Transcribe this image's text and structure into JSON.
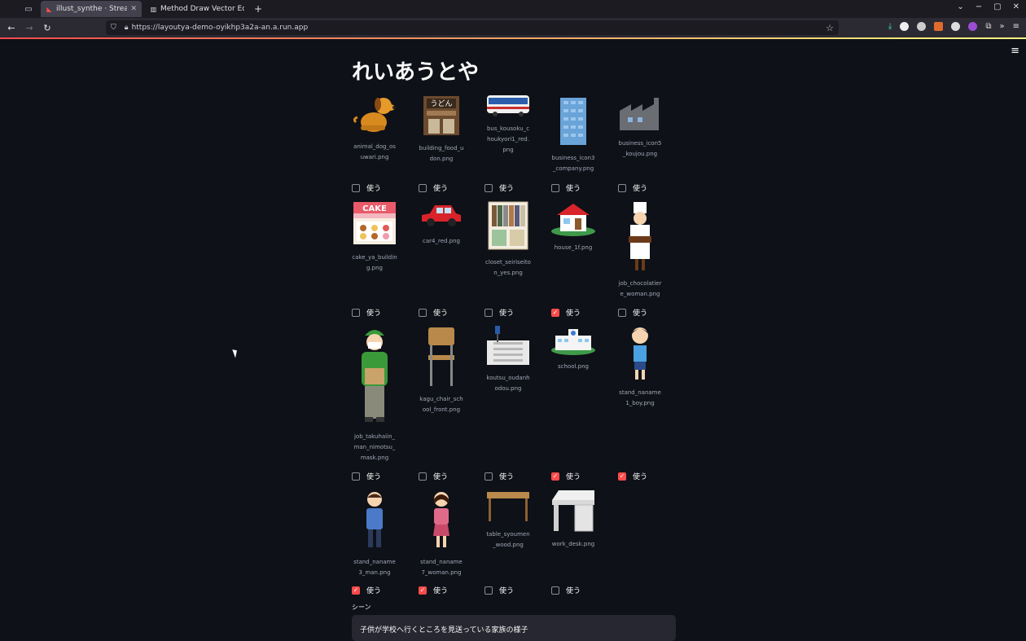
{
  "browser": {
    "tabs": [
      {
        "title": "illust_synthe · Streamlit",
        "active": true
      },
      {
        "title": "Method Draw Vector Edit",
        "active": false
      }
    ],
    "url": "https://layoutya-demo-oyikhp3a2a-an.a.run.app"
  },
  "app": {
    "title": "れいあうとや",
    "use_label": "使う",
    "scene_label": "シーン",
    "scene_value": "子供が学校へ行くところを見送っている家族の様子",
    "accent_color": "#ff4b4b"
  },
  "items": [
    {
      "file": "animal_dog_osuwari.png",
      "checked": false,
      "icon": "dog-illustration"
    },
    {
      "file": "building_food_udon.png",
      "checked": false,
      "icon": "udon-shop-illustration"
    },
    {
      "file": "bus_kousoku_choukyori1_red.png",
      "checked": false,
      "icon": "bus-illustration"
    },
    {
      "file": "business_icon3_company.png",
      "checked": false,
      "icon": "office-building-icon"
    },
    {
      "file": "business_icon5_koujou.png",
      "checked": false,
      "icon": "factory-icon"
    },
    {
      "file": "cake_ya_building.png",
      "checked": false,
      "icon": "cake-shop-illustration"
    },
    {
      "file": "car4_red.png",
      "checked": false,
      "icon": "red-car-illustration"
    },
    {
      "file": "closet_seiriseiton_yes.png",
      "checked": false,
      "icon": "closet-illustration"
    },
    {
      "file": "house_1f.png",
      "checked": true,
      "icon": "house-illustration"
    },
    {
      "file": "job_chocolatiere_woman.png",
      "checked": false,
      "icon": "chocolatier-illustration"
    },
    {
      "file": "job_takuhaiin_man_nimotsu_mask.png",
      "checked": false,
      "icon": "delivery-man-illustration"
    },
    {
      "file": "kagu_chair_school_front.png",
      "checked": false,
      "icon": "school-chair-illustration"
    },
    {
      "file": "koutsu_oudanhodou.png",
      "checked": false,
      "icon": "crosswalk-illustration"
    },
    {
      "file": "school.png",
      "checked": true,
      "icon": "school-illustration"
    },
    {
      "file": "stand_naname1_boy.png",
      "checked": true,
      "icon": "boy-illustration"
    },
    {
      "file": "stand_naname3_man.png",
      "checked": true,
      "icon": "man-illustration"
    },
    {
      "file": "stand_naname7_woman.png",
      "checked": true,
      "icon": "woman-illustration"
    },
    {
      "file": "table_syoumen_wood.png",
      "checked": false,
      "icon": "wood-table-illustration"
    },
    {
      "file": "work_desk.png",
      "checked": false,
      "icon": "work-desk-illustration"
    }
  ]
}
